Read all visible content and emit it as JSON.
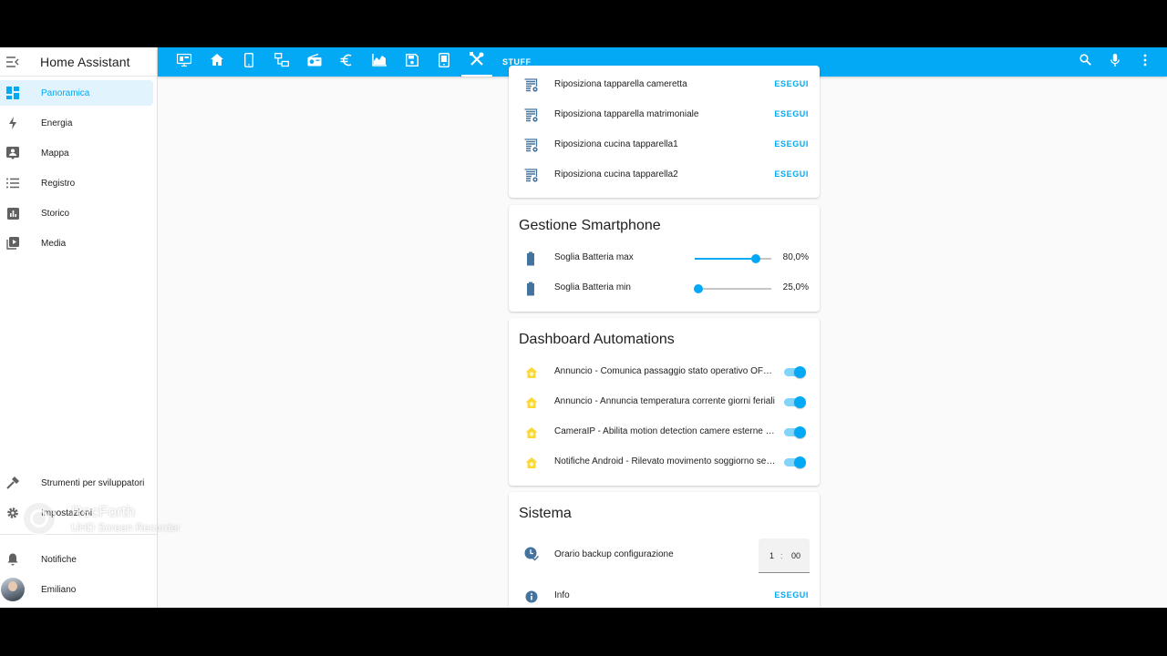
{
  "app": {
    "title": "Home Assistant"
  },
  "sidebar": {
    "items": [
      {
        "label": "Panoramica",
        "icon": "dashboard-icon",
        "active": true
      },
      {
        "label": "Energia",
        "icon": "lightning-bolt-icon"
      },
      {
        "label": "Mappa",
        "icon": "map-account-icon"
      },
      {
        "label": "Registro",
        "icon": "format-list-bulleted-icon"
      },
      {
        "label": "Storico",
        "icon": "chart-box-icon"
      },
      {
        "label": "Media",
        "icon": "play-box-multiple-icon"
      }
    ],
    "bottom_items": [
      {
        "label": "Strumenti per sviluppatori",
        "icon": "hammer-icon"
      },
      {
        "label": "Impostazioni",
        "icon": "cog-icon"
      },
      {
        "label": "Notifiche",
        "icon": "bell-icon"
      },
      {
        "label": "Emiliano",
        "icon": "user-avatar"
      }
    ]
  },
  "topbar": {
    "tabs": [
      "monitor-dashboard-icon",
      "home-icon",
      "cellphone-icon",
      "lan-connect-icon",
      "radio-icon",
      "currency-eur-icon",
      "chart-areaspline-icon",
      "content-save-icon",
      "tablet-icon",
      "tools-icon"
    ],
    "active_tab": 9,
    "text_tab": "STUFF",
    "accent": "#03a9f4"
  },
  "cards": {
    "scripts": {
      "rows": [
        {
          "label": "Riposiziona tapparella cameretta",
          "action": "ESEGUI"
        },
        {
          "label": "Riposiziona tapparella matrimoniale",
          "action": "ESEGUI"
        },
        {
          "label": "Riposiziona cucina tapparella1",
          "action": "ESEGUI"
        },
        {
          "label": "Riposiziona cucina tapparella2",
          "action": "ESEGUI"
        }
      ]
    },
    "smartphone": {
      "title": "Gestione Smartphone",
      "rows": [
        {
          "label": "Soglia Batteria max",
          "value": "80,0%",
          "level": 0.8
        },
        {
          "label": "Soglia Batteria min",
          "value": "25,0%",
          "level": 0.0
        }
      ]
    },
    "automations": {
      "title": "Dashboard Automations",
      "rows": [
        {
          "label": "Annuncio - Comunica passaggio stato operativo OFF el...",
          "on": true
        },
        {
          "label": "Annuncio - Annuncia temperatura corrente giorni feriali",
          "on": true
        },
        {
          "label": "CameraIP - Abilita motion detection camere esterne se...",
          "on": true
        },
        {
          "label": "Notifiche Android - Rilevato movimento soggiorno se s...",
          "on": true
        }
      ]
    },
    "sistema": {
      "title": "Sistema",
      "backup": {
        "label": "Orario backup configurazione",
        "hour": "1",
        "sep": ":",
        "minute": "00"
      },
      "info": {
        "label": "Info",
        "action": "ESEGUI"
      }
    }
  },
  "watermark": {
    "line1": "RecForth",
    "line2": "UHD Screen Recorder"
  }
}
